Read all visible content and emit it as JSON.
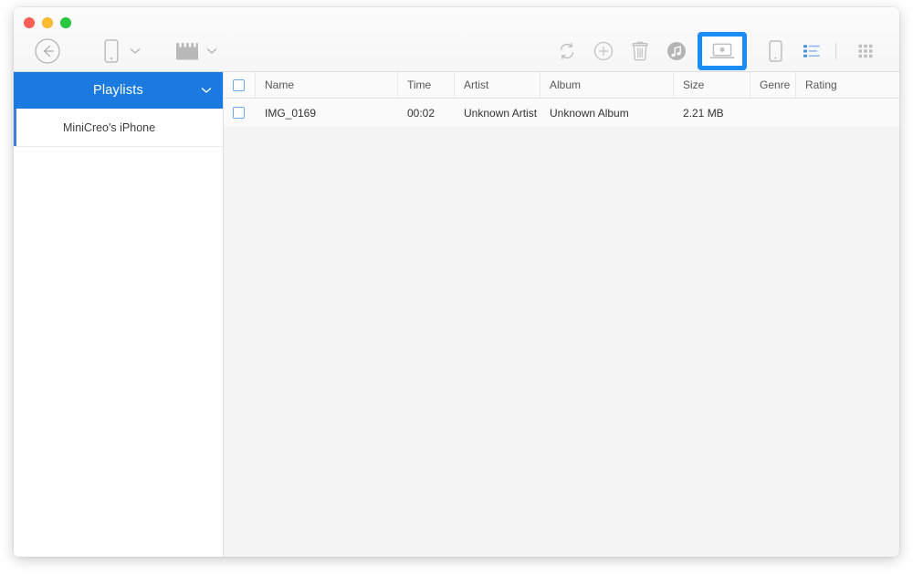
{
  "window": {
    "traffic_lights": [
      "close",
      "minimize",
      "maximize"
    ],
    "colors": {
      "accent_blue": "#1b7ae0",
      "highlight_blue": "#1b8cf3",
      "sidebar_accent": "#3f7fd8",
      "active_icon_blue": "#4a90e2",
      "icon_gray": "#b9b9b9",
      "content_bg": "#f4f4f4",
      "row_bg": "#fafafa",
      "header_bg": "#fbfbfb"
    }
  },
  "toolbar": {
    "left": [
      {
        "name": "back-button",
        "icon": "back-arrow-circle-icon"
      },
      {
        "name": "device-selector",
        "icon": "phone-icon"
      },
      {
        "name": "device-selector-chevron",
        "icon": "chevron-down-icon"
      },
      {
        "name": "media-type-selector",
        "icon": "movie-clapperboard-icon"
      },
      {
        "name": "media-type-chevron",
        "icon": "chevron-down-icon"
      }
    ],
    "right": [
      {
        "name": "refresh-button",
        "icon": "refresh-icon"
      },
      {
        "name": "add-button",
        "icon": "plus-circle-icon"
      },
      {
        "name": "delete-button",
        "icon": "trash-icon"
      },
      {
        "name": "itunes-button",
        "icon": "itunes-music-note-icon"
      },
      {
        "name": "export-to-mac-button",
        "icon": "laptop-icon",
        "highlighted": true
      },
      {
        "name": "export-to-device-button",
        "icon": "phone-icon"
      },
      {
        "name": "list-view-button",
        "icon": "list-view-icon",
        "active": true
      },
      {
        "name": "grid-view-button",
        "icon": "grid-view-icon",
        "active": false
      }
    ]
  },
  "sidebar": {
    "header": {
      "title": "Playlists",
      "chevron": "chevron-down-icon"
    },
    "items": [
      {
        "label": "MiniCreo's iPhone",
        "selected": true
      }
    ]
  },
  "table": {
    "select_all_checked": false,
    "columns": [
      {
        "key": "checkbox",
        "label": ""
      },
      {
        "key": "name",
        "label": "Name"
      },
      {
        "key": "time",
        "label": "Time"
      },
      {
        "key": "artist",
        "label": "Artist"
      },
      {
        "key": "album",
        "label": "Album"
      },
      {
        "key": "size",
        "label": "Size"
      },
      {
        "key": "genre",
        "label": "Genre"
      },
      {
        "key": "rating",
        "label": "Rating"
      }
    ],
    "rows": [
      {
        "checked": false,
        "name": "IMG_0169",
        "time": "00:02",
        "artist": "Unknown Artist",
        "album": "Unknown Album",
        "size": "2.21 MB",
        "genre": "",
        "rating": ""
      }
    ]
  }
}
